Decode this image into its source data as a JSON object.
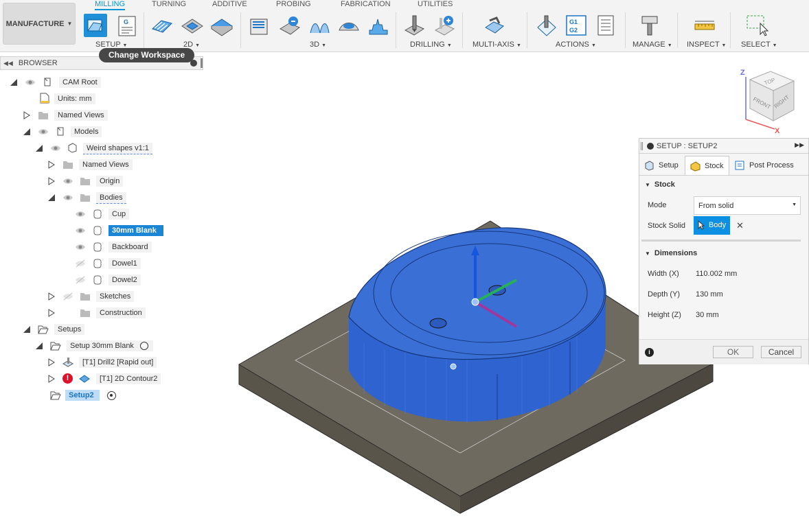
{
  "toolbar": {
    "workspace_label": "MANUFACTURE",
    "workspace_tabs": [
      "MILLING",
      "TURNING",
      "ADDITIVE",
      "PROBING",
      "FABRICATION",
      "UTILITIES"
    ],
    "groups": {
      "setup": "SETUP",
      "two_d": "2D",
      "three_d": "3D",
      "drilling": "DRILLING",
      "multi_axis": "MULTI-AXIS",
      "actions": "ACTIONS",
      "manage": "MANAGE",
      "inspect": "INSPECT",
      "select": "SELECT"
    },
    "g_label": "G",
    "g1g2_label": "G1\nG2",
    "tooltip": "Change Workspace"
  },
  "browser": {
    "title": "BROWSER",
    "items": {
      "cam_root": "CAM Root",
      "units": "Units: mm",
      "named_views": "Named Views",
      "models": "Models",
      "model": "Weird shapes v1:1",
      "model_named_views": "Named Views",
      "origin": "Origin",
      "bodies": "Bodies",
      "cup": "Cup",
      "blank": "30mm Blank",
      "backboard": "Backboard",
      "dowel1": "Dowel1",
      "dowel2": "Dowel2",
      "sketches": "Sketches",
      "construction": "Construction",
      "setups": "Setups",
      "setup1": "Setup 30mm Blank",
      "op1": "[T1] Drill2 [Rapid out]",
      "op2": "[T1] 2D Contour2",
      "setup2": "Setup2"
    }
  },
  "viewcube": {
    "top": "TOP",
    "front": "FRONT",
    "right": "RIGHT",
    "z": "Z",
    "x": "X"
  },
  "setup_panel": {
    "title": "SETUP : SETUP2",
    "tabs": {
      "setup": "Setup",
      "stock": "Stock",
      "post": "Post Process"
    },
    "stock_section": "Stock",
    "mode_label": "Mode",
    "mode_value": "From solid",
    "stock_solid_label": "Stock Solid",
    "body_button": "Body",
    "dimensions_section": "Dimensions",
    "width_label": "Width (X)",
    "width_value": "110.002 mm",
    "depth_label": "Depth (Y)",
    "depth_value": "130 mm",
    "height_label": "Height (Z)",
    "height_value": "30 mm",
    "ok": "OK",
    "cancel": "Cancel"
  },
  "colors": {
    "accent": "#0696d7",
    "selection": "#1b86d6",
    "part_blue": "#3a70d6",
    "plate": "#6f6a5f"
  }
}
